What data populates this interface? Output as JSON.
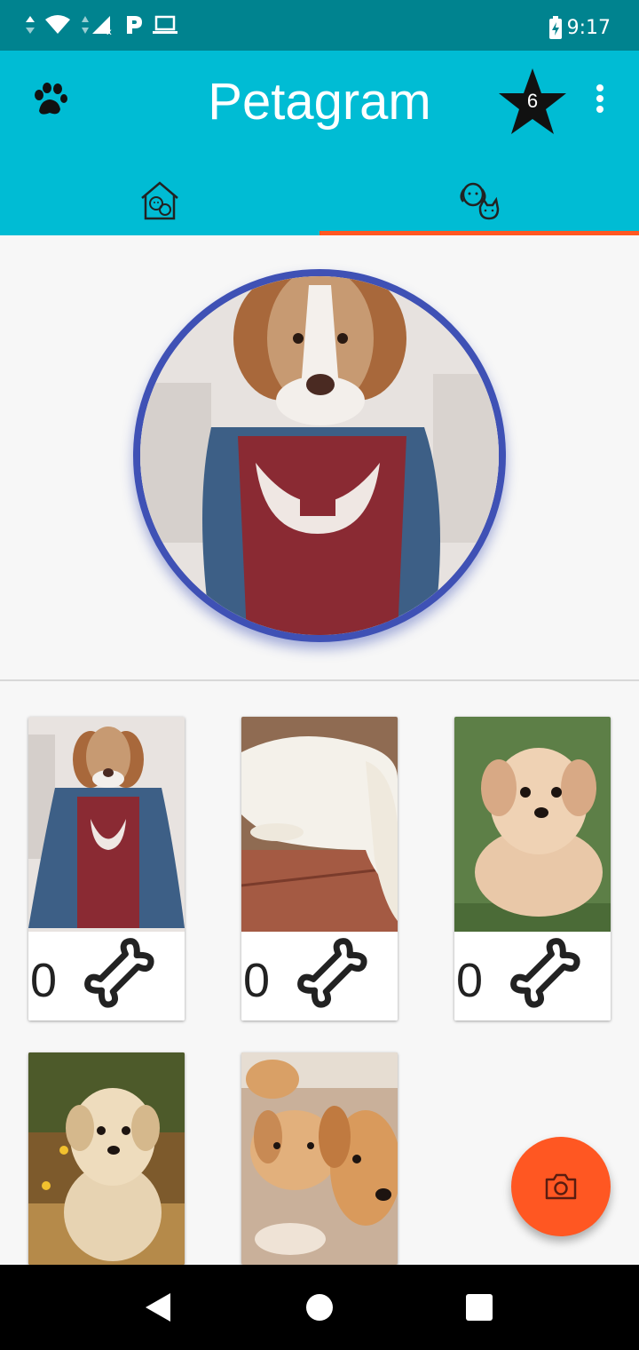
{
  "status_bar": {
    "time": "9:17",
    "icons": [
      "data-arrows-icon",
      "wifi-icon",
      "signal-icon",
      "parking-icon",
      "laptop-icon",
      "battery-charging-icon"
    ]
  },
  "app_bar": {
    "title": "Petagram",
    "favorites_count": "6",
    "tabs": [
      {
        "name": "home-pets-tab",
        "icon": "house-pets-icon",
        "selected": false
      },
      {
        "name": "profile-pets-tab",
        "icon": "dog-cat-icon",
        "selected": true
      }
    ]
  },
  "profile": {
    "image": "beagle-in-superhero-cape",
    "border_color": "#3f51b5"
  },
  "grid": [
    {
      "likes": "0",
      "image": "beagle-in-superhero-cape"
    },
    {
      "likes": "0",
      "image": "white-puppy-stretching"
    },
    {
      "likes": "0",
      "image": "fluffy-tan-puppy"
    },
    {
      "image": "shaggy-terrier-puppy-in-grass"
    },
    {
      "image": "golden-retriever-puppies"
    }
  ],
  "colors": {
    "primary": "#00bcd4",
    "primary_dark": "#00838f",
    "accent": "#ff5722",
    "profile_ring": "#3f51b5"
  },
  "fab": {
    "icon": "camera-icon"
  },
  "nav_bar": {
    "icons": [
      "back-icon",
      "home-icon",
      "recents-icon"
    ]
  }
}
